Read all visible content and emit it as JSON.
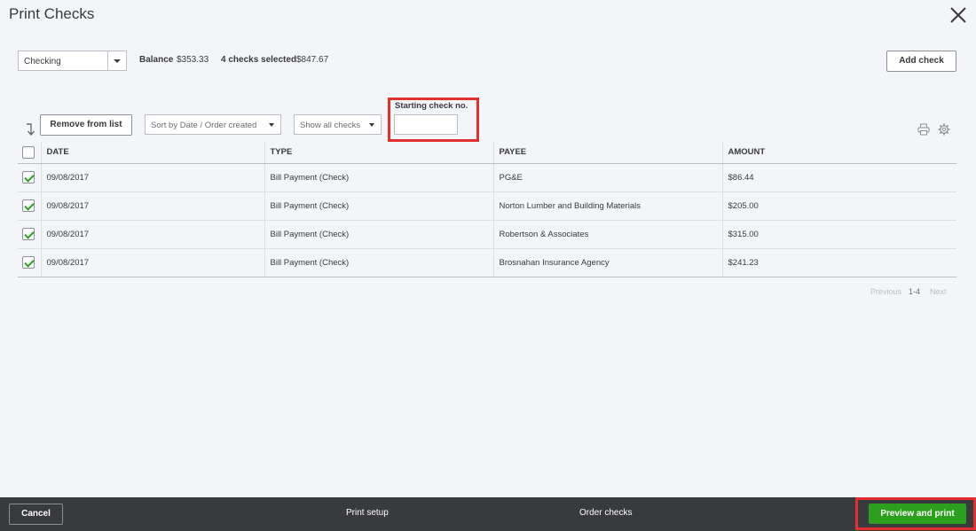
{
  "header": {
    "title": "Print Checks",
    "close_icon": "close-icon"
  },
  "toolbar": {
    "account": "Checking",
    "balance_label": "Balance",
    "balance_value": "$353.33",
    "selected_label": "4 checks selected",
    "selected_value": "$847.67",
    "add_check": "Add check"
  },
  "filters": {
    "remove_from_list": "Remove from list",
    "sort": "Sort by Date / Order created",
    "show": "Show all checks",
    "starting_label": "Starting check no.",
    "starting_value": ""
  },
  "table": {
    "columns": [
      "DATE",
      "TYPE",
      "PAYEE",
      "AMOUNT"
    ],
    "rows": [
      {
        "checked": true,
        "date": "09/08/2017",
        "type": "Bill Payment (Check)",
        "payee": "PG&E",
        "amount": "$86.44"
      },
      {
        "checked": true,
        "date": "09/08/2017",
        "type": "Bill Payment (Check)",
        "payee": "Norton Lumber and Building Materials",
        "amount": "$205.00"
      },
      {
        "checked": true,
        "date": "09/08/2017",
        "type": "Bill Payment (Check)",
        "payee": "Robertson & Associates",
        "amount": "$315.00"
      },
      {
        "checked": true,
        "date": "09/08/2017",
        "type": "Bill Payment (Check)",
        "payee": "Brosnahan Insurance Agency",
        "amount": "$241.23"
      }
    ]
  },
  "pager": {
    "previous": "Previous",
    "range": "1-4",
    "next": "Next"
  },
  "footer": {
    "cancel": "Cancel",
    "print_setup": "Print setup",
    "order_checks": "Order checks",
    "preview_print": "Preview and print"
  },
  "colors": {
    "accent_green": "#2ca01c",
    "highlight_red": "#e2302f",
    "footer_bg": "#393a3d"
  }
}
